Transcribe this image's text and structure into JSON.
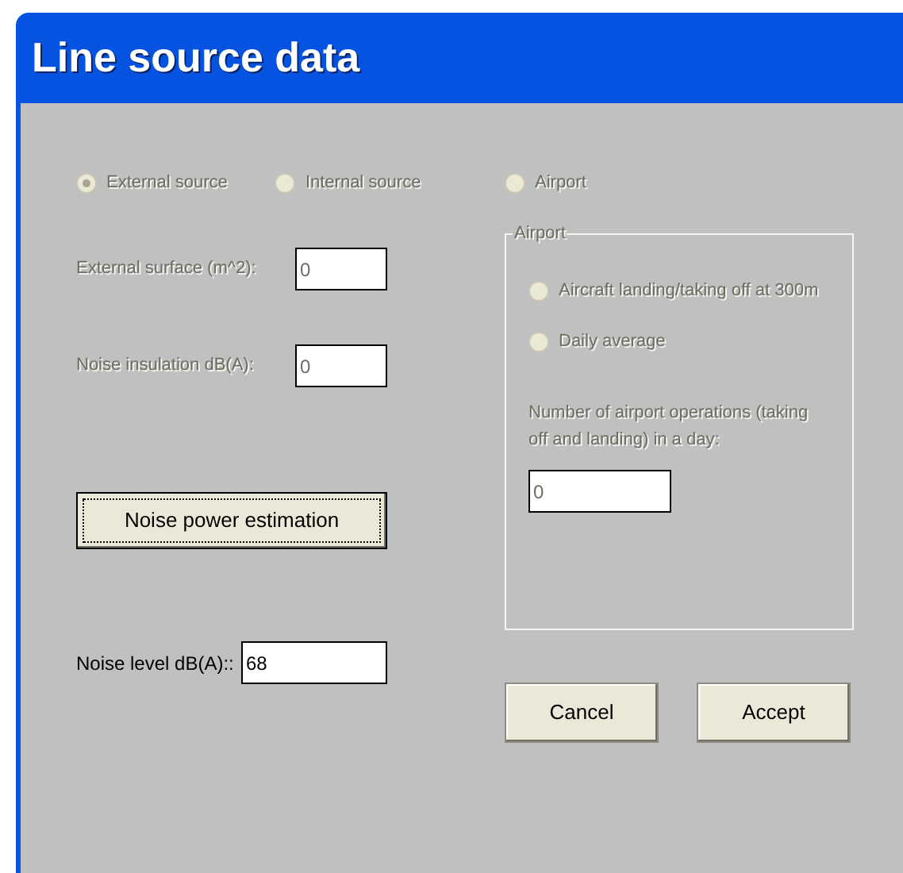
{
  "window": {
    "title": "Line source data"
  },
  "source_options": [
    {
      "label": "External source",
      "selected": true,
      "disabled": true
    },
    {
      "label": "Internal source",
      "selected": false,
      "disabled": true
    },
    {
      "label": "Airport",
      "selected": false,
      "disabled": true
    }
  ],
  "left_fields": [
    {
      "label": "External surface (m^2):",
      "value": "0",
      "disabled": true
    },
    {
      "label": "Noise insulation dB(A):",
      "value": "0",
      "disabled": true
    }
  ],
  "estimate_button": {
    "label": "Noise power estimation",
    "focused": true
  },
  "noise_level": {
    "label": "Noise level dB(A)::",
    "value": "68",
    "disabled": false
  },
  "airport_group": {
    "title": "Airport",
    "disabled": true,
    "options": [
      {
        "label": "Aircraft landing/taking off at 300m",
        "selected": false
      },
      {
        "label": "Daily average",
        "selected": false
      }
    ],
    "operations": {
      "label": "Number of airport operations (taking off and landing) in a day:",
      "value": "0"
    }
  },
  "buttons": [
    {
      "label": "Cancel"
    },
    {
      "label": "Accept"
    }
  ]
}
